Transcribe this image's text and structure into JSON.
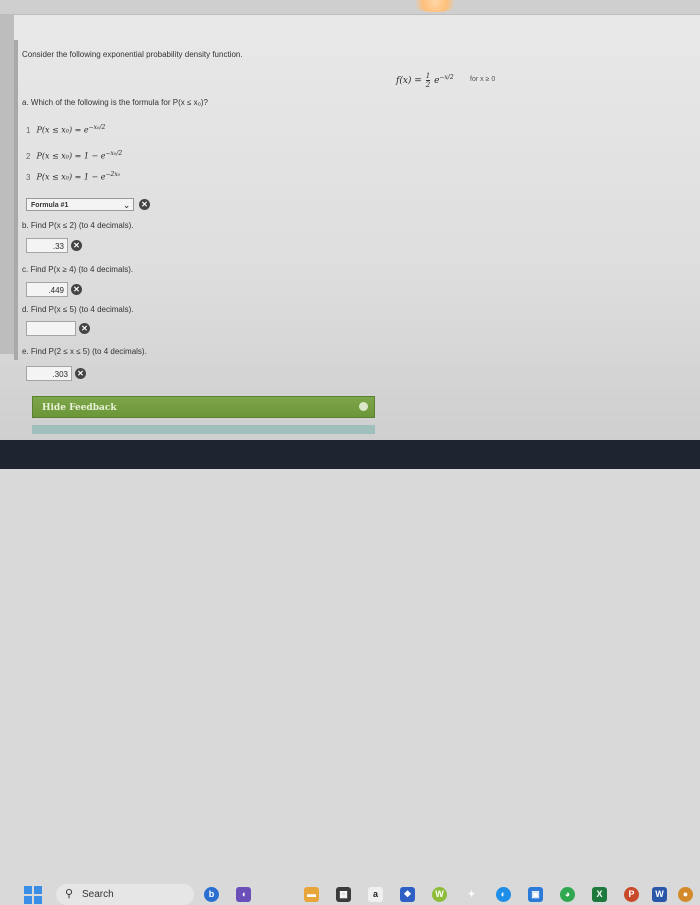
{
  "question": {
    "intro": "Consider the following exponential probability density function.",
    "pdf_left": "f(x) =",
    "pdf_frac_num": "1",
    "pdf_frac_den": "2",
    "pdf_exp_base": "e",
    "pdf_exp_power": "−x/2",
    "pdf_domain": "for  x ≥ 0"
  },
  "part_a": {
    "prompt": "a. Which of the following is the formula for P(x ≤ x₀)?",
    "options": [
      {
        "num": "1",
        "expr": "P(x ≤ x₀) = e",
        "power": "−x₀/2"
      },
      {
        "num": "2",
        "expr": "P(x ≤ x₀) = 1 − e",
        "power": "−x₀/2"
      },
      {
        "num": "3",
        "expr": "P(x ≤ x₀) = 1 − e",
        "power": "−2x₀"
      }
    ],
    "selected": "Formula #1"
  },
  "part_b": {
    "prompt": "b. Find P(x ≤ 2) (to 4 decimals).",
    "answer": ".33"
  },
  "part_c": {
    "prompt": "c. Find P(x ≥ 4) (to 4 decimals).",
    "answer": ".449"
  },
  "part_d": {
    "prompt": "d. Find P(x ≤ 5) (to 4 decimals).",
    "answer": ""
  },
  "part_e": {
    "prompt": "e. Find P(2 ≤ x ≤ 5) (to 4 decimals).",
    "answer": ".303"
  },
  "feedback": {
    "label": "Hide Feedback"
  },
  "taskbar": {
    "search_label": "Search"
  },
  "icons": {
    "wrong": "x-circle-icon",
    "dropdown": "chevron-down-icon",
    "search": "magnifier-icon"
  }
}
